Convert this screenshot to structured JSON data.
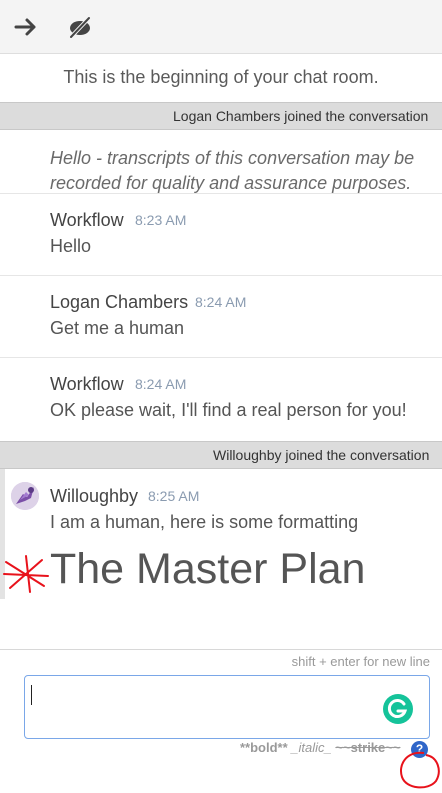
{
  "toolbar": {
    "icons": [
      "arrow-right-icon",
      "eye-slash-icon"
    ]
  },
  "chat": {
    "beginning_text": "This is the beginning of your chat room.",
    "events": [
      {
        "text": "Logan Chambers joined the conversation"
      },
      {
        "text": "Willoughby joined the conversation"
      }
    ],
    "notice": "Hello - transcripts of this conversation may be recorded for quality and assurance purposes.",
    "messages": [
      {
        "author": "Workflow",
        "time": "8:23 AM",
        "text": "Hello"
      },
      {
        "author": "Logan Chambers",
        "time": "8:24 AM",
        "text": "Get me a human"
      },
      {
        "author": "Workflow",
        "time": "8:24 AM",
        "text": "OK please wait, I'll find a real person for you!"
      },
      {
        "author": "Willoughby",
        "time": "8:25 AM",
        "text": "I am a human, here is some formatting",
        "heading": "The Master Plan"
      }
    ]
  },
  "composer": {
    "hint": "shift + enter for new line",
    "value": "",
    "format_hint": {
      "bold": "**bold**",
      "italic": "_italic_",
      "strike": "~~strike~~"
    },
    "help_label": "?"
  },
  "colors": {
    "toolbar_bg": "#f4f4f4",
    "event_bg": "#dcdcdc",
    "timestamp": "#8a9bb0",
    "grammarly": "#15c39a",
    "help": "#2f66c9",
    "annotation": "#e8121b"
  }
}
